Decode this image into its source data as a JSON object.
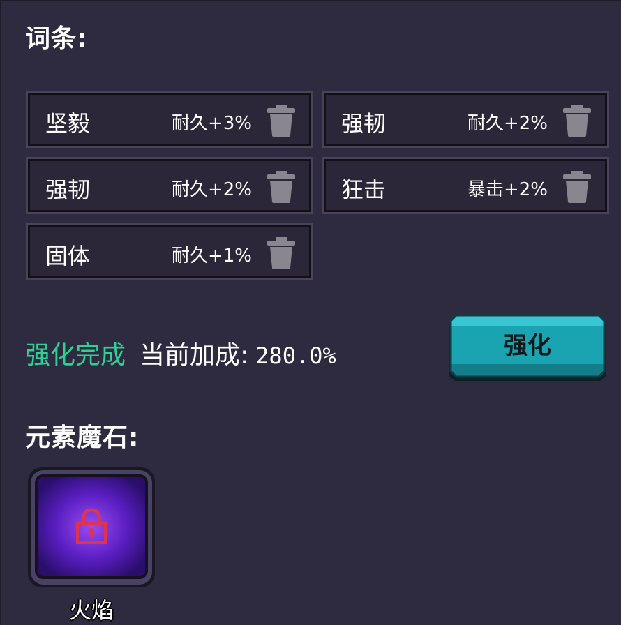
{
  "sections": {
    "affix_title": "词条:",
    "stone_title": "元素魔石:"
  },
  "affixes": [
    {
      "name": "坚毅",
      "value": "耐久+3%"
    },
    {
      "name": "强韧",
      "value": "耐久+2%"
    },
    {
      "name": "强韧",
      "value": "耐久+2%"
    },
    {
      "name": "狂击",
      "value": "暴击+2%"
    },
    {
      "name": "固体",
      "value": "耐久+1%"
    }
  ],
  "status": {
    "done": "强化完成",
    "bonus_label": "当前加成:",
    "bonus_value": "280.0%"
  },
  "enhance_button": {
    "label": "强化"
  },
  "element_stone": {
    "label": "火焰",
    "locked": true,
    "icon": "lock-icon"
  },
  "colors": {
    "background": "#2e2a3f",
    "done_text": "#2fcf96",
    "button": "#1aa3b0",
    "lock": "#e0334e",
    "slot_glow": "#7a2ee0",
    "trash": "#8a8690"
  }
}
